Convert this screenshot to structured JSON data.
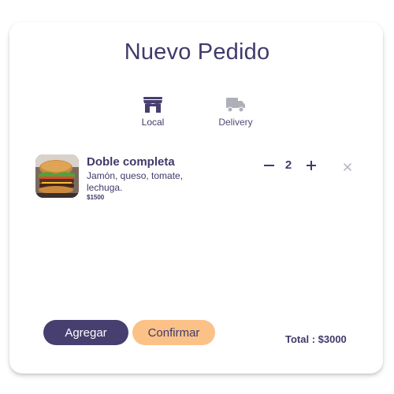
{
  "header": {
    "title": "Nuevo Pedido"
  },
  "order_modes": [
    {
      "label": "Local",
      "icon": "store-icon",
      "active": true
    },
    {
      "label": "Delivery",
      "icon": "truck-icon",
      "active": false
    }
  ],
  "items": [
    {
      "name": "Doble completa",
      "description": "Jamón, queso, tomate, lechuga.",
      "price": "$1500",
      "quantity": "2",
      "image": "burger-image"
    }
  ],
  "actions": {
    "add_label": "Agregar",
    "confirm_label": "Confirmar"
  },
  "total": {
    "text": "Total : $3000"
  },
  "colors": {
    "primary": "#463f6f",
    "text": "#3f3a6b",
    "accent": "#fbc187",
    "icon_inactive": "#aeb0b8",
    "remove_icon": "#b7b9c4"
  }
}
